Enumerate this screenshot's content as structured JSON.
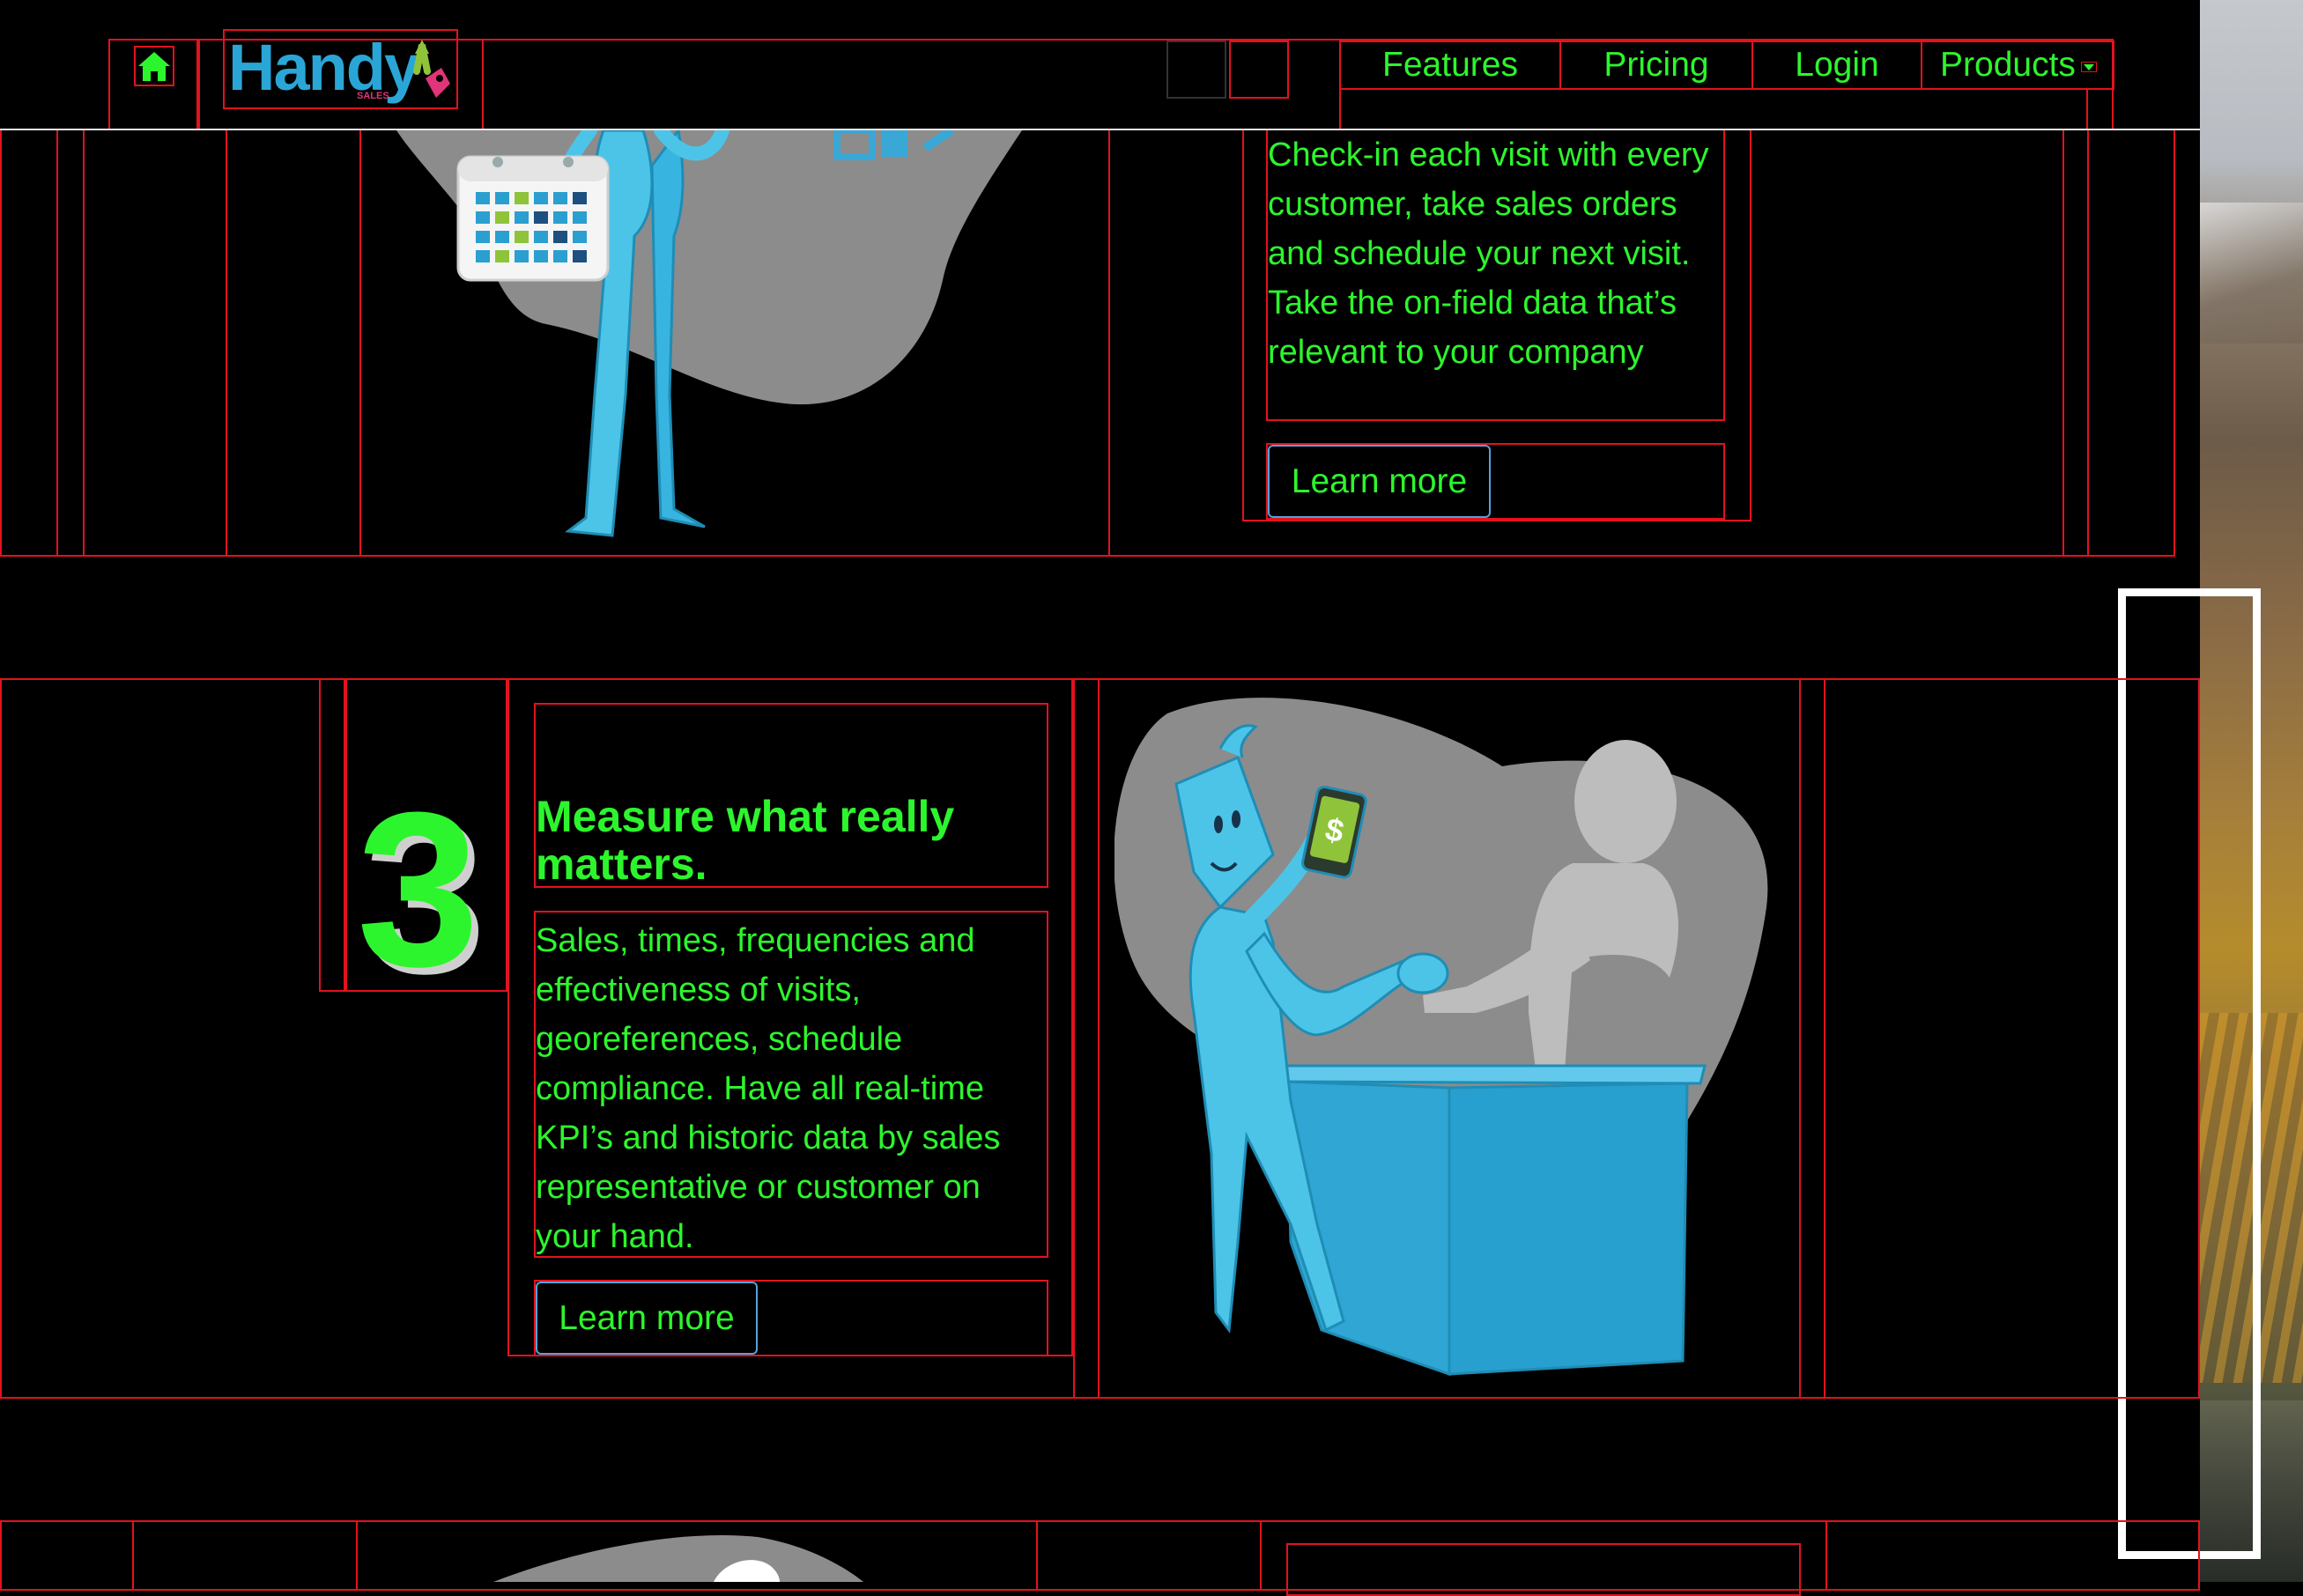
{
  "nav": {
    "logo_text": "Handy",
    "logo_sub": "SALES",
    "links": [
      "Features",
      "Pricing",
      "Login",
      "Products"
    ]
  },
  "section2": {
    "body": "Check-in each visit with every customer, take sales orders and schedule your next visit. Take the on-field data that’s relevant to your company",
    "cta": "Learn more"
  },
  "section3": {
    "number": "3",
    "heading": "Measure what really matters.",
    "body": "Sales, times, frequencies and effectiveness of visits, georeferences, schedule compliance. Have all real-time KPI’s and historic data by sales representative or customer on your hand.",
    "cta": "Learn more"
  },
  "illustration3": {
    "price_symbol": "$"
  },
  "colors": {
    "accent": "#2df52d",
    "background": "#000000",
    "debug_outline": "#e2121e",
    "figure_blue": "#4cc4e8"
  }
}
